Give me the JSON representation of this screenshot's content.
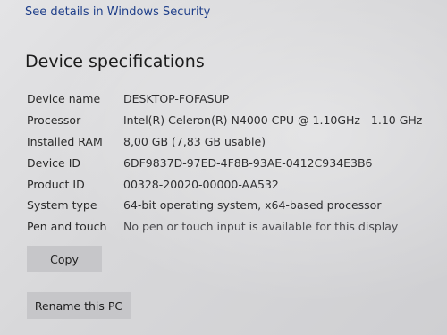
{
  "security_link": "See details in Windows Security",
  "section_title": "Device specifications",
  "specs": [
    {
      "label": "Device name",
      "value": "DESKTOP-FOFASUP"
    },
    {
      "label": "Processor",
      "value": "Intel(R) Celeron(R) N4000 CPU @ 1.10GHz   1.10 GHz"
    },
    {
      "label": "Installed RAM",
      "value": "8,00 GB (7,83 GB usable)"
    },
    {
      "label": "Device ID",
      "value": "6DF9837D-97ED-4F8B-93AE-0412C934E3B6"
    },
    {
      "label": "Product ID",
      "value": "00328-20020-00000-AA532"
    },
    {
      "label": "System type",
      "value": "64-bit operating system, x64-based processor"
    },
    {
      "label": "Pen and touch",
      "value": "No pen or touch input is available for this display"
    }
  ],
  "buttons": {
    "copy": "Copy",
    "rename": "Rename this PC"
  }
}
